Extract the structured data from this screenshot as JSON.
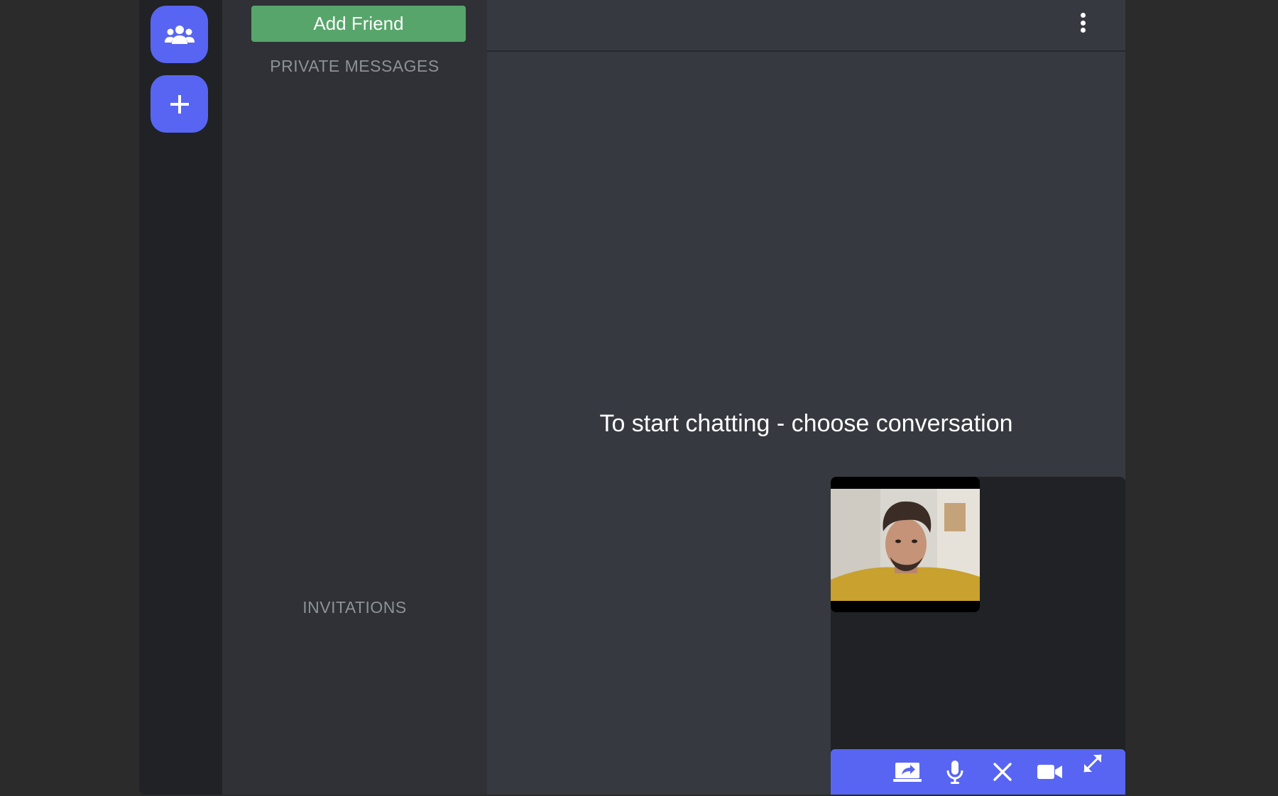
{
  "sidebar": {
    "add_friend_label": "Add Friend",
    "private_messages_label": "PRIVATE MESSAGES",
    "invitations_label": "INVITATIONS"
  },
  "rail": {
    "items": [
      {
        "icon": "users-icon"
      },
      {
        "icon": "plus-icon"
      }
    ]
  },
  "main": {
    "empty_state": "To start chatting - choose conversation"
  },
  "call": {
    "controls": [
      "share-screen-icon",
      "microphone-icon",
      "close-icon",
      "camera-icon",
      "expand-icon"
    ]
  },
  "colors": {
    "accent": "#5865f2",
    "add_friend": "#57a56a",
    "rail_bg": "#202225",
    "sidebar_bg": "#2f3136",
    "main_bg": "#36393f"
  }
}
